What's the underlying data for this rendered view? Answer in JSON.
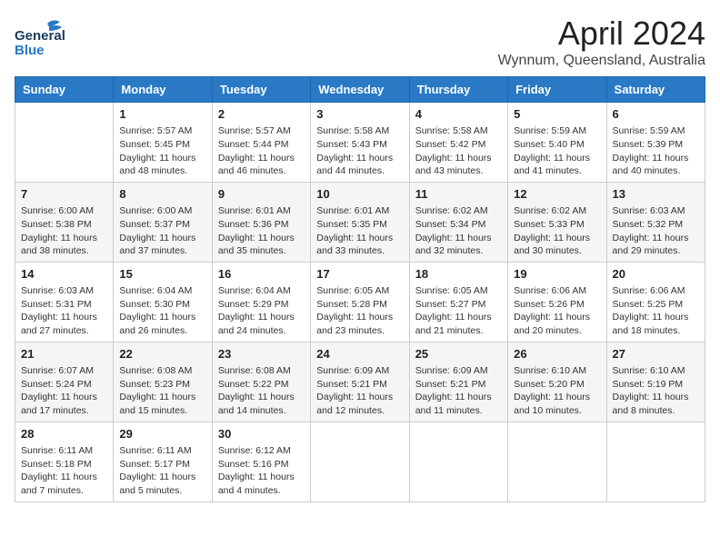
{
  "logo": {
    "general": "General",
    "blue": "Blue"
  },
  "title": {
    "month": "April 2024",
    "location": "Wynnum, Queensland, Australia"
  },
  "days_of_week": [
    "Sunday",
    "Monday",
    "Tuesday",
    "Wednesday",
    "Thursday",
    "Friday",
    "Saturday"
  ],
  "weeks": [
    [
      {
        "day": "",
        "info": ""
      },
      {
        "day": "1",
        "info": "Sunrise: 5:57 AM\nSunset: 5:45 PM\nDaylight: 11 hours\nand 48 minutes."
      },
      {
        "day": "2",
        "info": "Sunrise: 5:57 AM\nSunset: 5:44 PM\nDaylight: 11 hours\nand 46 minutes."
      },
      {
        "day": "3",
        "info": "Sunrise: 5:58 AM\nSunset: 5:43 PM\nDaylight: 11 hours\nand 44 minutes."
      },
      {
        "day": "4",
        "info": "Sunrise: 5:58 AM\nSunset: 5:42 PM\nDaylight: 11 hours\nand 43 minutes."
      },
      {
        "day": "5",
        "info": "Sunrise: 5:59 AM\nSunset: 5:40 PM\nDaylight: 11 hours\nand 41 minutes."
      },
      {
        "day": "6",
        "info": "Sunrise: 5:59 AM\nSunset: 5:39 PM\nDaylight: 11 hours\nand 40 minutes."
      }
    ],
    [
      {
        "day": "7",
        "info": "Sunrise: 6:00 AM\nSunset: 5:38 PM\nDaylight: 11 hours\nand 38 minutes."
      },
      {
        "day": "8",
        "info": "Sunrise: 6:00 AM\nSunset: 5:37 PM\nDaylight: 11 hours\nand 37 minutes."
      },
      {
        "day": "9",
        "info": "Sunrise: 6:01 AM\nSunset: 5:36 PM\nDaylight: 11 hours\nand 35 minutes."
      },
      {
        "day": "10",
        "info": "Sunrise: 6:01 AM\nSunset: 5:35 PM\nDaylight: 11 hours\nand 33 minutes."
      },
      {
        "day": "11",
        "info": "Sunrise: 6:02 AM\nSunset: 5:34 PM\nDaylight: 11 hours\nand 32 minutes."
      },
      {
        "day": "12",
        "info": "Sunrise: 6:02 AM\nSunset: 5:33 PM\nDaylight: 11 hours\nand 30 minutes."
      },
      {
        "day": "13",
        "info": "Sunrise: 6:03 AM\nSunset: 5:32 PM\nDaylight: 11 hours\nand 29 minutes."
      }
    ],
    [
      {
        "day": "14",
        "info": "Sunrise: 6:03 AM\nSunset: 5:31 PM\nDaylight: 11 hours\nand 27 minutes."
      },
      {
        "day": "15",
        "info": "Sunrise: 6:04 AM\nSunset: 5:30 PM\nDaylight: 11 hours\nand 26 minutes."
      },
      {
        "day": "16",
        "info": "Sunrise: 6:04 AM\nSunset: 5:29 PM\nDaylight: 11 hours\nand 24 minutes."
      },
      {
        "day": "17",
        "info": "Sunrise: 6:05 AM\nSunset: 5:28 PM\nDaylight: 11 hours\nand 23 minutes."
      },
      {
        "day": "18",
        "info": "Sunrise: 6:05 AM\nSunset: 5:27 PM\nDaylight: 11 hours\nand 21 minutes."
      },
      {
        "day": "19",
        "info": "Sunrise: 6:06 AM\nSunset: 5:26 PM\nDaylight: 11 hours\nand 20 minutes."
      },
      {
        "day": "20",
        "info": "Sunrise: 6:06 AM\nSunset: 5:25 PM\nDaylight: 11 hours\nand 18 minutes."
      }
    ],
    [
      {
        "day": "21",
        "info": "Sunrise: 6:07 AM\nSunset: 5:24 PM\nDaylight: 11 hours\nand 17 minutes."
      },
      {
        "day": "22",
        "info": "Sunrise: 6:08 AM\nSunset: 5:23 PM\nDaylight: 11 hours\nand 15 minutes."
      },
      {
        "day": "23",
        "info": "Sunrise: 6:08 AM\nSunset: 5:22 PM\nDaylight: 11 hours\nand 14 minutes."
      },
      {
        "day": "24",
        "info": "Sunrise: 6:09 AM\nSunset: 5:21 PM\nDaylight: 11 hours\nand 12 minutes."
      },
      {
        "day": "25",
        "info": "Sunrise: 6:09 AM\nSunset: 5:21 PM\nDaylight: 11 hours\nand 11 minutes."
      },
      {
        "day": "26",
        "info": "Sunrise: 6:10 AM\nSunset: 5:20 PM\nDaylight: 11 hours\nand 10 minutes."
      },
      {
        "day": "27",
        "info": "Sunrise: 6:10 AM\nSunset: 5:19 PM\nDaylight: 11 hours\nand 8 minutes."
      }
    ],
    [
      {
        "day": "28",
        "info": "Sunrise: 6:11 AM\nSunset: 5:18 PM\nDaylight: 11 hours\nand 7 minutes."
      },
      {
        "day": "29",
        "info": "Sunrise: 6:11 AM\nSunset: 5:17 PM\nDaylight: 11 hours\nand 5 minutes."
      },
      {
        "day": "30",
        "info": "Sunrise: 6:12 AM\nSunset: 5:16 PM\nDaylight: 11 hours\nand 4 minutes."
      },
      {
        "day": "",
        "info": ""
      },
      {
        "day": "",
        "info": ""
      },
      {
        "day": "",
        "info": ""
      },
      {
        "day": "",
        "info": ""
      }
    ]
  ]
}
